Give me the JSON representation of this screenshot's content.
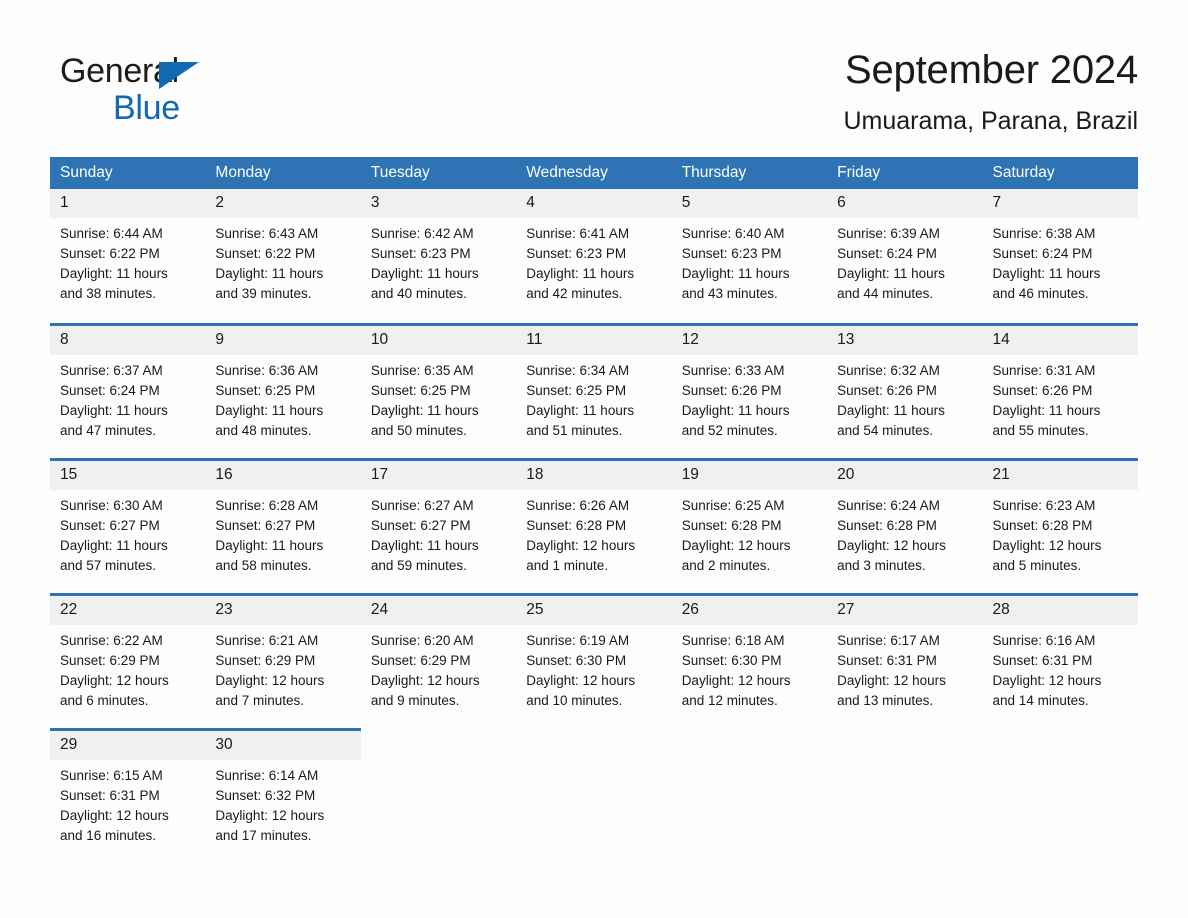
{
  "brand": {
    "name_part1": "General",
    "name_part2": "Blue",
    "triangle_color": "#1168b3"
  },
  "header": {
    "title": "September 2024",
    "location": "Umuarama, Parana, Brazil"
  },
  "colors": {
    "header_blue": "#2e73b4",
    "daynum_band": "#f0f0f0",
    "page_background": "#fdfdfd",
    "text": "#1a1a1a"
  },
  "weekday_headers": [
    "Sunday",
    "Monday",
    "Tuesday",
    "Wednesday",
    "Thursday",
    "Friday",
    "Saturday"
  ],
  "weeks": [
    [
      {
        "day": "1",
        "sunrise": "Sunrise: 6:44 AM",
        "sunset": "Sunset: 6:22 PM",
        "daylight_line1": "Daylight: 11 hours",
        "daylight_line2": "and 38 minutes."
      },
      {
        "day": "2",
        "sunrise": "Sunrise: 6:43 AM",
        "sunset": "Sunset: 6:22 PM",
        "daylight_line1": "Daylight: 11 hours",
        "daylight_line2": "and 39 minutes."
      },
      {
        "day": "3",
        "sunrise": "Sunrise: 6:42 AM",
        "sunset": "Sunset: 6:23 PM",
        "daylight_line1": "Daylight: 11 hours",
        "daylight_line2": "and 40 minutes."
      },
      {
        "day": "4",
        "sunrise": "Sunrise: 6:41 AM",
        "sunset": "Sunset: 6:23 PM",
        "daylight_line1": "Daylight: 11 hours",
        "daylight_line2": "and 42 minutes."
      },
      {
        "day": "5",
        "sunrise": "Sunrise: 6:40 AM",
        "sunset": "Sunset: 6:23 PM",
        "daylight_line1": "Daylight: 11 hours",
        "daylight_line2": "and 43 minutes."
      },
      {
        "day": "6",
        "sunrise": "Sunrise: 6:39 AM",
        "sunset": "Sunset: 6:24 PM",
        "daylight_line1": "Daylight: 11 hours",
        "daylight_line2": "and 44 minutes."
      },
      {
        "day": "7",
        "sunrise": "Sunrise: 6:38 AM",
        "sunset": "Sunset: 6:24 PM",
        "daylight_line1": "Daylight: 11 hours",
        "daylight_line2": "and 46 minutes."
      }
    ],
    [
      {
        "day": "8",
        "sunrise": "Sunrise: 6:37 AM",
        "sunset": "Sunset: 6:24 PM",
        "daylight_line1": "Daylight: 11 hours",
        "daylight_line2": "and 47 minutes."
      },
      {
        "day": "9",
        "sunrise": "Sunrise: 6:36 AM",
        "sunset": "Sunset: 6:25 PM",
        "daylight_line1": "Daylight: 11 hours",
        "daylight_line2": "and 48 minutes."
      },
      {
        "day": "10",
        "sunrise": "Sunrise: 6:35 AM",
        "sunset": "Sunset: 6:25 PM",
        "daylight_line1": "Daylight: 11 hours",
        "daylight_line2": "and 50 minutes."
      },
      {
        "day": "11",
        "sunrise": "Sunrise: 6:34 AM",
        "sunset": "Sunset: 6:25 PM",
        "daylight_line1": "Daylight: 11 hours",
        "daylight_line2": "and 51 minutes."
      },
      {
        "day": "12",
        "sunrise": "Sunrise: 6:33 AM",
        "sunset": "Sunset: 6:26 PM",
        "daylight_line1": "Daylight: 11 hours",
        "daylight_line2": "and 52 minutes."
      },
      {
        "day": "13",
        "sunrise": "Sunrise: 6:32 AM",
        "sunset": "Sunset: 6:26 PM",
        "daylight_line1": "Daylight: 11 hours",
        "daylight_line2": "and 54 minutes."
      },
      {
        "day": "14",
        "sunrise": "Sunrise: 6:31 AM",
        "sunset": "Sunset: 6:26 PM",
        "daylight_line1": "Daylight: 11 hours",
        "daylight_line2": "and 55 minutes."
      }
    ],
    [
      {
        "day": "15",
        "sunrise": "Sunrise: 6:30 AM",
        "sunset": "Sunset: 6:27 PM",
        "daylight_line1": "Daylight: 11 hours",
        "daylight_line2": "and 57 minutes."
      },
      {
        "day": "16",
        "sunrise": "Sunrise: 6:28 AM",
        "sunset": "Sunset: 6:27 PM",
        "daylight_line1": "Daylight: 11 hours",
        "daylight_line2": "and 58 minutes."
      },
      {
        "day": "17",
        "sunrise": "Sunrise: 6:27 AM",
        "sunset": "Sunset: 6:27 PM",
        "daylight_line1": "Daylight: 11 hours",
        "daylight_line2": "and 59 minutes."
      },
      {
        "day": "18",
        "sunrise": "Sunrise: 6:26 AM",
        "sunset": "Sunset: 6:28 PM",
        "daylight_line1": "Daylight: 12 hours",
        "daylight_line2": "and 1 minute."
      },
      {
        "day": "19",
        "sunrise": "Sunrise: 6:25 AM",
        "sunset": "Sunset: 6:28 PM",
        "daylight_line1": "Daylight: 12 hours",
        "daylight_line2": "and 2 minutes."
      },
      {
        "day": "20",
        "sunrise": "Sunrise: 6:24 AM",
        "sunset": "Sunset: 6:28 PM",
        "daylight_line1": "Daylight: 12 hours",
        "daylight_line2": "and 3 minutes."
      },
      {
        "day": "21",
        "sunrise": "Sunrise: 6:23 AM",
        "sunset": "Sunset: 6:28 PM",
        "daylight_line1": "Daylight: 12 hours",
        "daylight_line2": "and 5 minutes."
      }
    ],
    [
      {
        "day": "22",
        "sunrise": "Sunrise: 6:22 AM",
        "sunset": "Sunset: 6:29 PM",
        "daylight_line1": "Daylight: 12 hours",
        "daylight_line2": "and 6 minutes."
      },
      {
        "day": "23",
        "sunrise": "Sunrise: 6:21 AM",
        "sunset": "Sunset: 6:29 PM",
        "daylight_line1": "Daylight: 12 hours",
        "daylight_line2": "and 7 minutes."
      },
      {
        "day": "24",
        "sunrise": "Sunrise: 6:20 AM",
        "sunset": "Sunset: 6:29 PM",
        "daylight_line1": "Daylight: 12 hours",
        "daylight_line2": "and 9 minutes."
      },
      {
        "day": "25",
        "sunrise": "Sunrise: 6:19 AM",
        "sunset": "Sunset: 6:30 PM",
        "daylight_line1": "Daylight: 12 hours",
        "daylight_line2": "and 10 minutes."
      },
      {
        "day": "26",
        "sunrise": "Sunrise: 6:18 AM",
        "sunset": "Sunset: 6:30 PM",
        "daylight_line1": "Daylight: 12 hours",
        "daylight_line2": "and 12 minutes."
      },
      {
        "day": "27",
        "sunrise": "Sunrise: 6:17 AM",
        "sunset": "Sunset: 6:31 PM",
        "daylight_line1": "Daylight: 12 hours",
        "daylight_line2": "and 13 minutes."
      },
      {
        "day": "28",
        "sunrise": "Sunrise: 6:16 AM",
        "sunset": "Sunset: 6:31 PM",
        "daylight_line1": "Daylight: 12 hours",
        "daylight_line2": "and 14 minutes."
      }
    ],
    [
      {
        "day": "29",
        "sunrise": "Sunrise: 6:15 AM",
        "sunset": "Sunset: 6:31 PM",
        "daylight_line1": "Daylight: 12 hours",
        "daylight_line2": "and 16 minutes."
      },
      {
        "day": "30",
        "sunrise": "Sunrise: 6:14 AM",
        "sunset": "Sunset: 6:32 PM",
        "daylight_line1": "Daylight: 12 hours",
        "daylight_line2": "and 17 minutes."
      },
      {
        "day": "",
        "sunrise": "",
        "sunset": "",
        "daylight_line1": "",
        "daylight_line2": ""
      },
      {
        "day": "",
        "sunrise": "",
        "sunset": "",
        "daylight_line1": "",
        "daylight_line2": ""
      },
      {
        "day": "",
        "sunrise": "",
        "sunset": "",
        "daylight_line1": "",
        "daylight_line2": ""
      },
      {
        "day": "",
        "sunrise": "",
        "sunset": "",
        "daylight_line1": "",
        "daylight_line2": ""
      },
      {
        "day": "",
        "sunrise": "",
        "sunset": "",
        "daylight_line1": "",
        "daylight_line2": ""
      }
    ]
  ]
}
